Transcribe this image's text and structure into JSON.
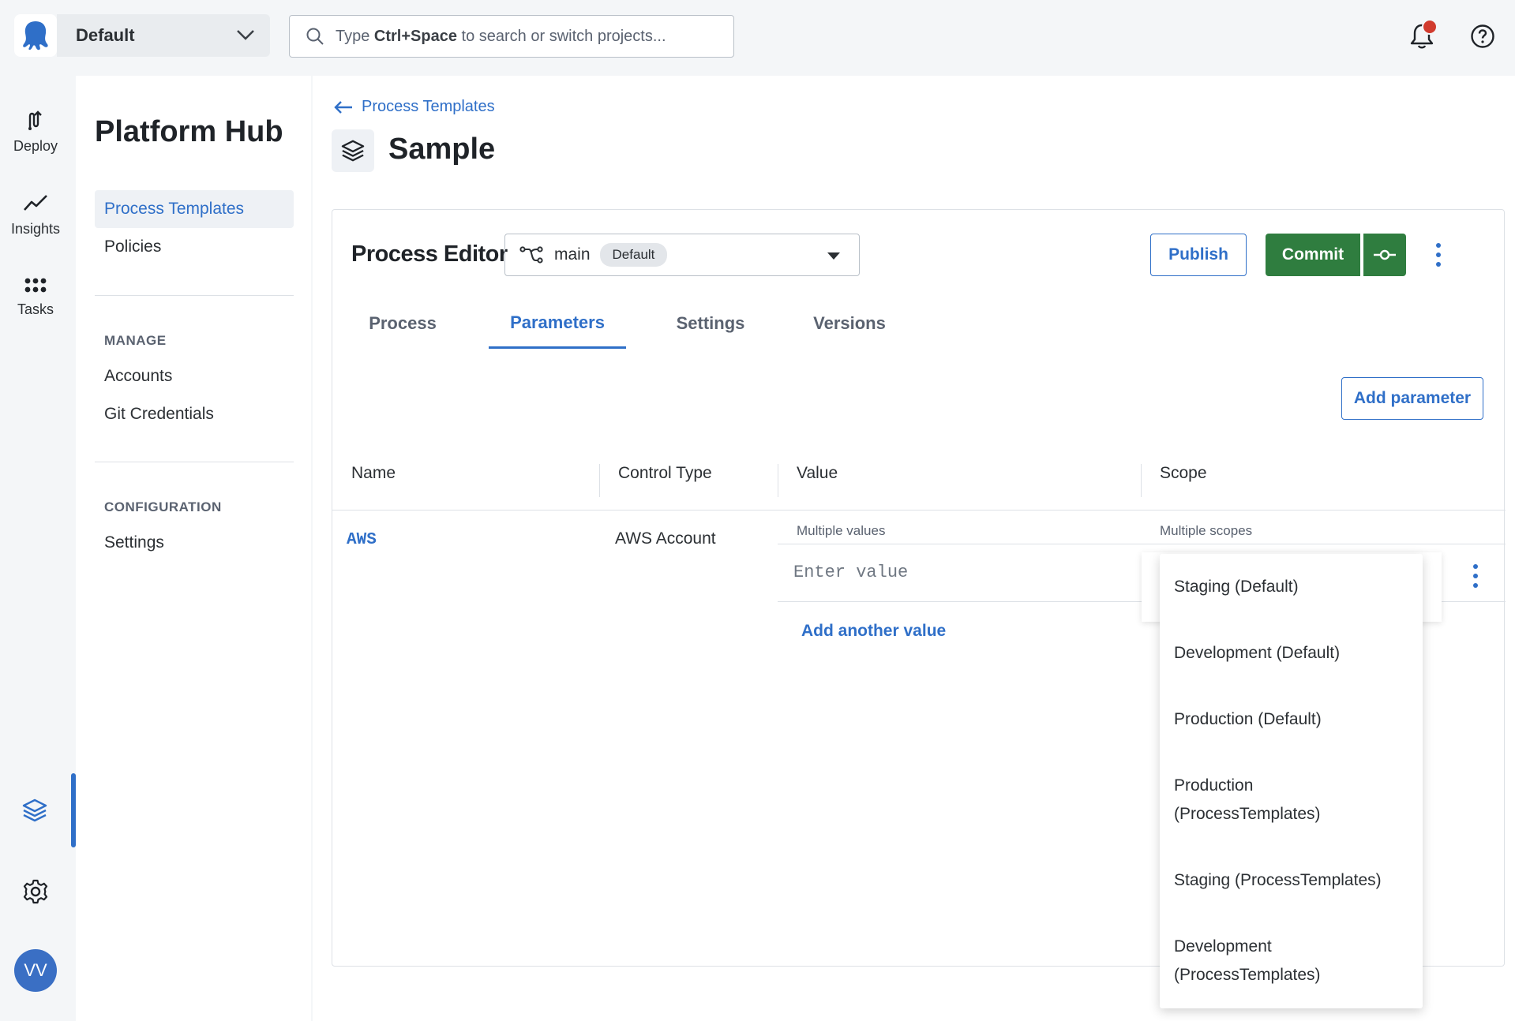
{
  "topbar": {
    "space_name": "Default",
    "search_placeholder_prefix": "Type ",
    "search_placeholder_shortcut": "Ctrl+Space",
    "search_placeholder_suffix": " to search or switch projects..."
  },
  "rail": {
    "items": [
      {
        "label": "Deploy",
        "icon": "deploy-icon"
      },
      {
        "label": "Insights",
        "icon": "insights-icon"
      },
      {
        "label": "Tasks",
        "icon": "tasks-icon"
      }
    ],
    "bottom": {
      "platform_hub_icon": "layers-icon",
      "settings_icon": "gear-icon",
      "avatar_initials": "VV"
    }
  },
  "subnav": {
    "title": "Platform Hub",
    "items": [
      {
        "label": "Process Templates",
        "active": true
      },
      {
        "label": "Policies",
        "active": false
      }
    ],
    "manage_heading": "MANAGE",
    "manage_items": [
      {
        "label": "Accounts"
      },
      {
        "label": "Git Credentials"
      }
    ],
    "config_heading": "CONFIGURATION",
    "config_items": [
      {
        "label": "Settings"
      }
    ]
  },
  "page": {
    "back_link": "Process Templates",
    "title": "Sample"
  },
  "editor": {
    "title": "Process Editor",
    "branch": "main",
    "branch_badge": "Default",
    "publish_label": "Publish",
    "commit_label": "Commit",
    "tabs": [
      {
        "label": "Process",
        "active": false
      },
      {
        "label": "Parameters",
        "active": true
      },
      {
        "label": "Settings",
        "active": false
      },
      {
        "label": "Versions",
        "active": false
      }
    ],
    "add_parameter_label": "Add parameter"
  },
  "table": {
    "columns": [
      "Name",
      "Control Type",
      "Value",
      "Scope"
    ],
    "rows": [
      {
        "name": "AWS",
        "control_type": "AWS Account",
        "value_summary": "Multiple values",
        "scope_summary": "Multiple scopes",
        "value_placeholder": "Enter value",
        "add_value_label": "Add another value"
      }
    ]
  },
  "scope_dropdown": {
    "options": [
      "Staging (Default)",
      "Development (Default)",
      "Production (Default)",
      "Production (ProcessTemplates)",
      "Staging (ProcessTemplates)",
      "Development (ProcessTemplates)"
    ]
  },
  "colors": {
    "accent": "#2f6fc8",
    "commit_green": "#2f7d3f",
    "notification": "#d13b2e"
  }
}
